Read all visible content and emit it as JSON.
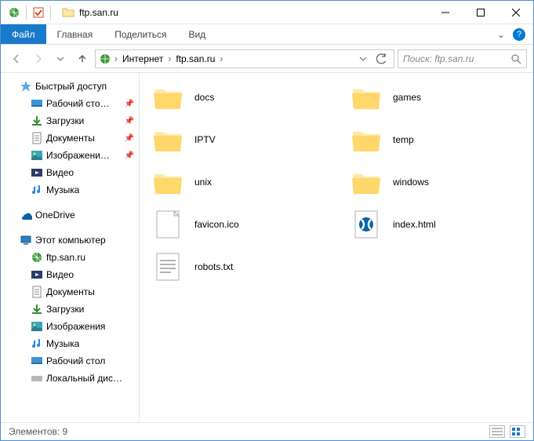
{
  "window": {
    "title": "ftp.san.ru"
  },
  "ribbon": {
    "file": "Файл",
    "tabs": [
      "Главная",
      "Поделиться",
      "Вид"
    ]
  },
  "breadcrumbs": [
    "Интернет",
    "ftp.san.ru"
  ],
  "search": {
    "placeholder": "Поиск: ftp.san.ru"
  },
  "sidebar": {
    "quick": {
      "label": "Быстрый доступ"
    },
    "quick_items": [
      {
        "label": "Рабочий сто…",
        "icon": "desktop",
        "pinned": true
      },
      {
        "label": "Загрузки",
        "icon": "downloads",
        "pinned": true
      },
      {
        "label": "Документы",
        "icon": "documents",
        "pinned": true
      },
      {
        "label": "Изображени…",
        "icon": "pictures",
        "pinned": true
      },
      {
        "label": "Видео",
        "icon": "video",
        "pinned": false
      },
      {
        "label": "Музыка",
        "icon": "music",
        "pinned": false
      }
    ],
    "onedrive": {
      "label": "OneDrive"
    },
    "thispc": {
      "label": "Этот компьютер"
    },
    "pc_items": [
      {
        "label": "ftp.san.ru",
        "icon": "globe"
      },
      {
        "label": "Видео",
        "icon": "video"
      },
      {
        "label": "Документы",
        "icon": "documents"
      },
      {
        "label": "Загрузки",
        "icon": "downloads"
      },
      {
        "label": "Изображения",
        "icon": "pictures"
      },
      {
        "label": "Музыка",
        "icon": "music"
      },
      {
        "label": "Рабочий стол",
        "icon": "desktop"
      },
      {
        "label": "Локальный дис…",
        "icon": "disk"
      }
    ]
  },
  "items": [
    {
      "name": "docs",
      "type": "folder"
    },
    {
      "name": "games",
      "type": "folder"
    },
    {
      "name": "IPTV",
      "type": "folder"
    },
    {
      "name": "temp",
      "type": "folder"
    },
    {
      "name": "unix",
      "type": "folder"
    },
    {
      "name": "windows",
      "type": "folder"
    },
    {
      "name": "favicon.ico",
      "type": "file"
    },
    {
      "name": "index.html",
      "type": "html"
    },
    {
      "name": "robots.txt",
      "type": "text"
    }
  ],
  "status": {
    "label": "Элементов:",
    "count": "9"
  }
}
